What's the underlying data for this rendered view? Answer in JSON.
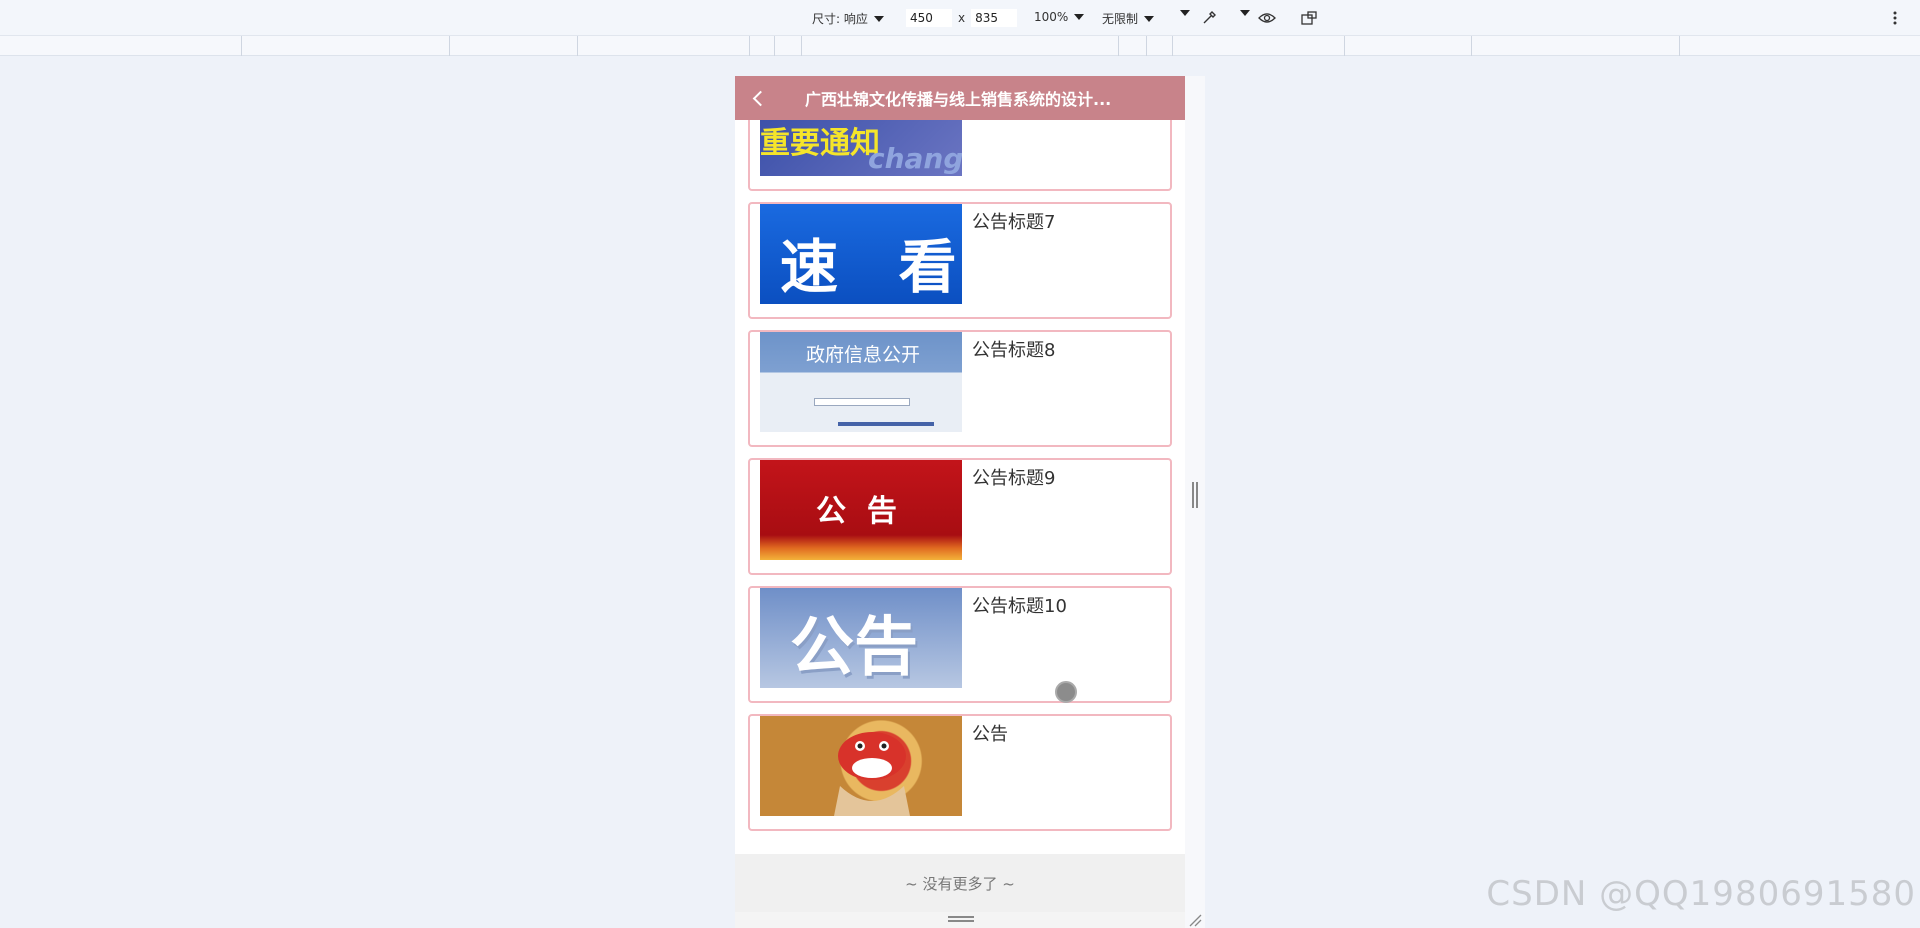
{
  "devtools": {
    "size_label": "尺寸: 响应",
    "width": "450",
    "times": "x",
    "height": "835",
    "zoom": "100%",
    "throttle": "无限制"
  },
  "app": {
    "title": "广西壮锦文化传播与线上销售系统的设计..."
  },
  "list": {
    "items": [
      {
        "title": "",
        "thumb_text": "重要通知",
        "thumb_subtext": "chang"
      },
      {
        "title": "公告标题7",
        "thumb_text": "速   看"
      },
      {
        "title": "公告标题8",
        "thumb_text": "政府信息公开"
      },
      {
        "title": "公告标题9",
        "thumb_text": "公  告"
      },
      {
        "title": "公告标题10",
        "thumb_text": "公告"
      },
      {
        "title": "公告",
        "thumb_text": ""
      }
    ]
  },
  "footer": {
    "text": "~ 没有更多了 ~"
  },
  "watermark": "CSDN @QQ1980691580",
  "colors": {
    "header": "#c8838a",
    "card_border": "#f2b8c0"
  }
}
